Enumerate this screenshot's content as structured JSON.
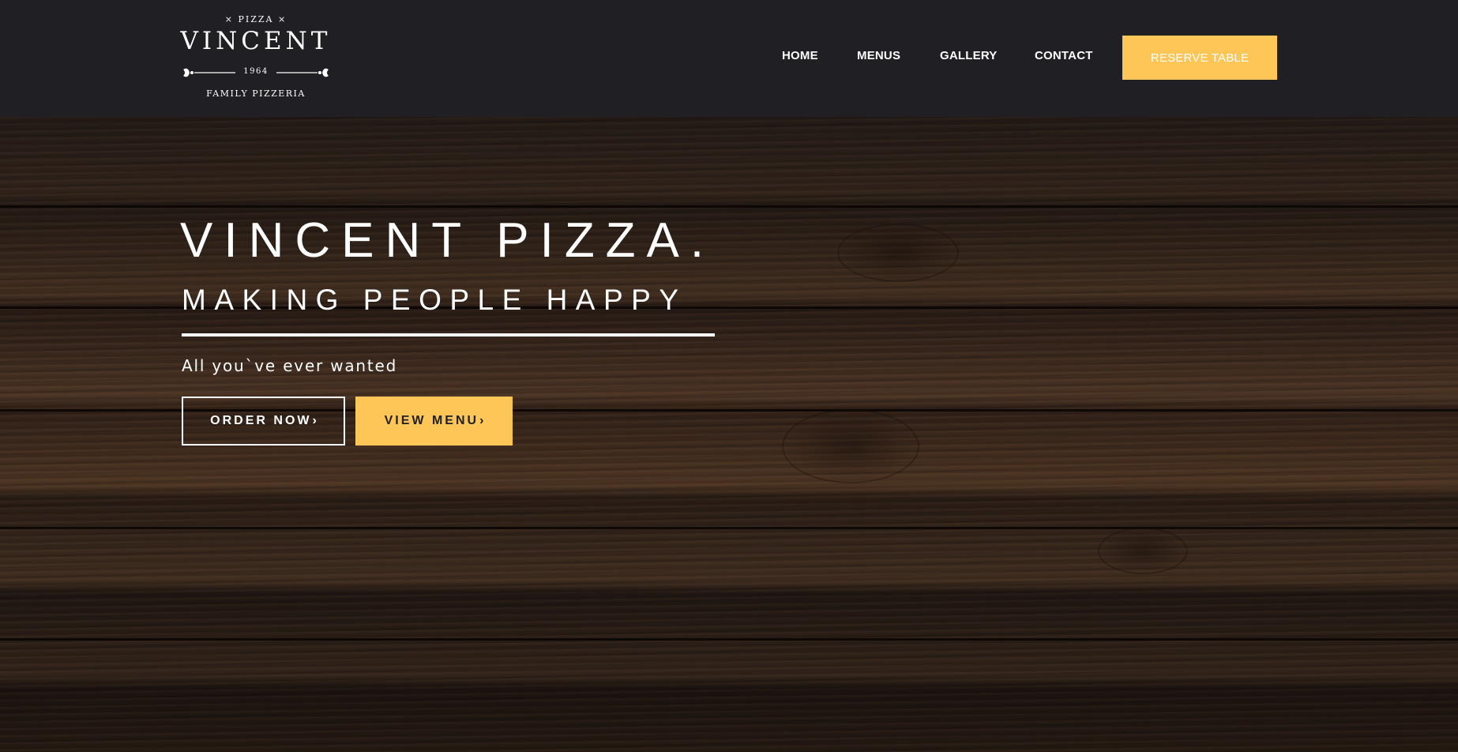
{
  "colors": {
    "header_bg": "#202024",
    "accent": "#fec557",
    "text": "#ffffff",
    "wood": "#3d2c22"
  },
  "logo": {
    "top_text": "× PIZZA ×",
    "name": "VINCENT",
    "year": "1964",
    "bottom_text": "FAMILY PIZZERIA"
  },
  "nav": {
    "items": [
      {
        "label": "HOME"
      },
      {
        "label": "MENUS"
      },
      {
        "label": "GALLERY"
      },
      {
        "label": "CONTACT"
      }
    ],
    "cta_label": "RESERVE TABLE"
  },
  "hero": {
    "title": "VINCENT PIZZA.",
    "subtitle": "MAKING PEOPLE HAPPY",
    "tagline": "All you`ve ever wanted",
    "buttons": [
      {
        "label": "ORDER NOW",
        "icon": "chevron-right-icon"
      },
      {
        "label": "VIEW MENU",
        "icon": "chevron-right-icon"
      }
    ]
  }
}
